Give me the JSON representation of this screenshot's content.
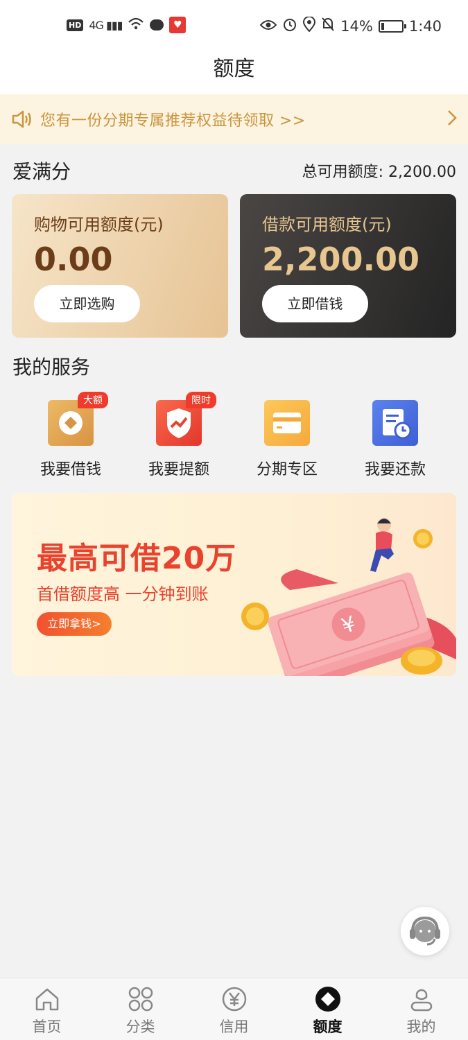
{
  "status_bar": {
    "hd": "HD",
    "network": "4G",
    "battery": "14%",
    "battery_level": 0.14,
    "time": "1:40"
  },
  "header": {
    "title": "额度"
  },
  "notice": {
    "text": "您有一份分期专属推荐权益待领取 >>",
    "icon": "speaker-icon"
  },
  "quota": {
    "section_title": "爱满分",
    "total_label": "总可用额度: 2,200.00",
    "shopping": {
      "label": "购物可用额度(元)",
      "amount": "0.00",
      "button": "立即选购"
    },
    "loan": {
      "label": "借款可用额度(元)",
      "amount": "2,200.00",
      "button": "立即借钱"
    }
  },
  "services": {
    "title": "我的服务",
    "items": [
      {
        "label": "我要借钱",
        "badge": "大额",
        "icon": "coin-diamond-icon",
        "color": "#e0a14a"
      },
      {
        "label": "我要提额",
        "badge": "限时",
        "icon": "shield-trend-icon",
        "color": "#ee4a3a"
      },
      {
        "label": "分期专区",
        "badge": "",
        "icon": "card-icon",
        "color": "#f8b94a"
      },
      {
        "label": "我要还款",
        "badge": "",
        "icon": "bill-clock-icon",
        "color": "#4a70e0"
      }
    ]
  },
  "banner": {
    "headline": "最高可借20万",
    "subline": "首借额度高  一分钟到账",
    "cta": "立即拿钱>"
  },
  "tabbar": {
    "items": [
      {
        "label": "首页",
        "icon": "home-icon",
        "active": false
      },
      {
        "label": "分类",
        "icon": "grid-icon",
        "active": false
      },
      {
        "label": "信用",
        "icon": "yen-icon",
        "active": false
      },
      {
        "label": "额度",
        "icon": "diamond-icon",
        "active": true
      },
      {
        "label": "我的",
        "icon": "user-icon",
        "active": false
      }
    ]
  },
  "colors": {
    "accent_gold": "#c9953f",
    "banner_red": "#e8432e",
    "loan_card_dark": "#242424"
  }
}
